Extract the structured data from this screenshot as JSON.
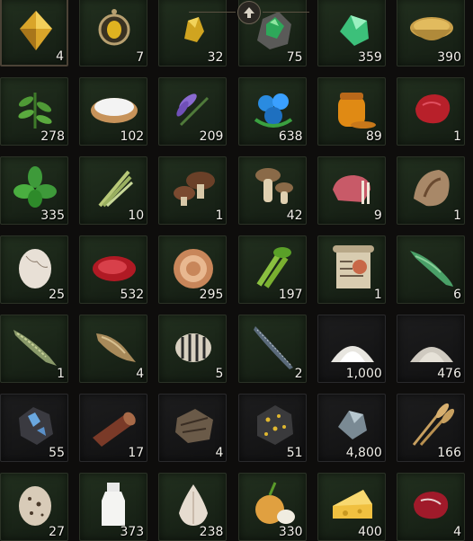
{
  "inventory": {
    "slots": [
      {
        "icon": "gold-gem-icon",
        "count": "4",
        "bg": "green",
        "selected": true
      },
      {
        "icon": "amulet-icon",
        "count": "7",
        "bg": "green"
      },
      {
        "icon": "gold-ore-icon",
        "count": "32",
        "bg": "green"
      },
      {
        "icon": "green-ore-icon",
        "count": "75",
        "bg": "green"
      },
      {
        "icon": "green-crystal-icon",
        "count": "359",
        "bg": "green"
      },
      {
        "icon": "spice-bowl-icon",
        "count": "390",
        "bg": "green"
      },
      {
        "icon": "herb-sprig-icon",
        "count": "278",
        "bg": "green"
      },
      {
        "icon": "salt-bowl-icon",
        "count": "102",
        "bg": "green"
      },
      {
        "icon": "lavender-icon",
        "count": "209",
        "bg": "green"
      },
      {
        "icon": "blue-berries-icon",
        "count": "638",
        "bg": "green"
      },
      {
        "icon": "honey-jar-icon",
        "count": "89",
        "bg": "green"
      },
      {
        "icon": "red-meat-icon",
        "count": "1",
        "bg": "green"
      },
      {
        "icon": "basil-icon",
        "count": "335",
        "bg": "green"
      },
      {
        "icon": "lemongrass-icon",
        "count": "10",
        "bg": "green"
      },
      {
        "icon": "shiitake-icon",
        "count": "1",
        "bg": "green"
      },
      {
        "icon": "mushroom-icon",
        "count": "42",
        "bg": "green"
      },
      {
        "icon": "rack-meat-icon",
        "count": "9",
        "bg": "green"
      },
      {
        "icon": "conch-shell-icon",
        "count": "1",
        "bg": "green"
      },
      {
        "icon": "egg-icon",
        "count": "25",
        "bg": "green"
      },
      {
        "icon": "red-meat-slice-icon",
        "count": "532",
        "bg": "green"
      },
      {
        "icon": "cream-swirl-icon",
        "count": "295",
        "bg": "green"
      },
      {
        "icon": "celery-icon",
        "count": "197",
        "bg": "green"
      },
      {
        "icon": "scroll-icon",
        "count": "1",
        "bg": "green"
      },
      {
        "icon": "arowana-fish-icon",
        "count": "6",
        "bg": "green"
      },
      {
        "icon": "pike-fish-icon",
        "count": "1",
        "bg": "green"
      },
      {
        "icon": "carp-fish-icon",
        "count": "4",
        "bg": "green"
      },
      {
        "icon": "striped-fish-icon",
        "count": "5",
        "bg": "green"
      },
      {
        "icon": "needle-fish-icon",
        "count": "2",
        "bg": "green"
      },
      {
        "icon": "white-powder-icon",
        "count": "1,000",
        "bg": "dark"
      },
      {
        "icon": "grey-powder-icon",
        "count": "476",
        "bg": "dark"
      },
      {
        "icon": "blue-ore-rock-icon",
        "count": "55",
        "bg": "dark"
      },
      {
        "icon": "timber-log-icon",
        "count": "17",
        "bg": "dark"
      },
      {
        "icon": "bark-icon",
        "count": "4",
        "bg": "dark"
      },
      {
        "icon": "gold-flecked-rock-icon",
        "count": "51",
        "bg": "dark"
      },
      {
        "icon": "grey-crystal-icon",
        "count": "4,800",
        "bg": "dark"
      },
      {
        "icon": "wheat-icon",
        "count": "166",
        "bg": "dark"
      },
      {
        "icon": "quail-egg-icon",
        "count": "27",
        "bg": "green"
      },
      {
        "icon": "milk-bottle-icon",
        "count": "373",
        "bg": "green"
      },
      {
        "icon": "garlic-icon",
        "count": "238",
        "bg": "green"
      },
      {
        "icon": "onion-icon",
        "count": "330",
        "bg": "green"
      },
      {
        "icon": "cheese-icon",
        "count": "400",
        "bg": "green"
      },
      {
        "icon": "beef-steak-icon",
        "count": "4",
        "bg": "green"
      }
    ]
  },
  "scroll_up_icon": "arrow-up-icon"
}
